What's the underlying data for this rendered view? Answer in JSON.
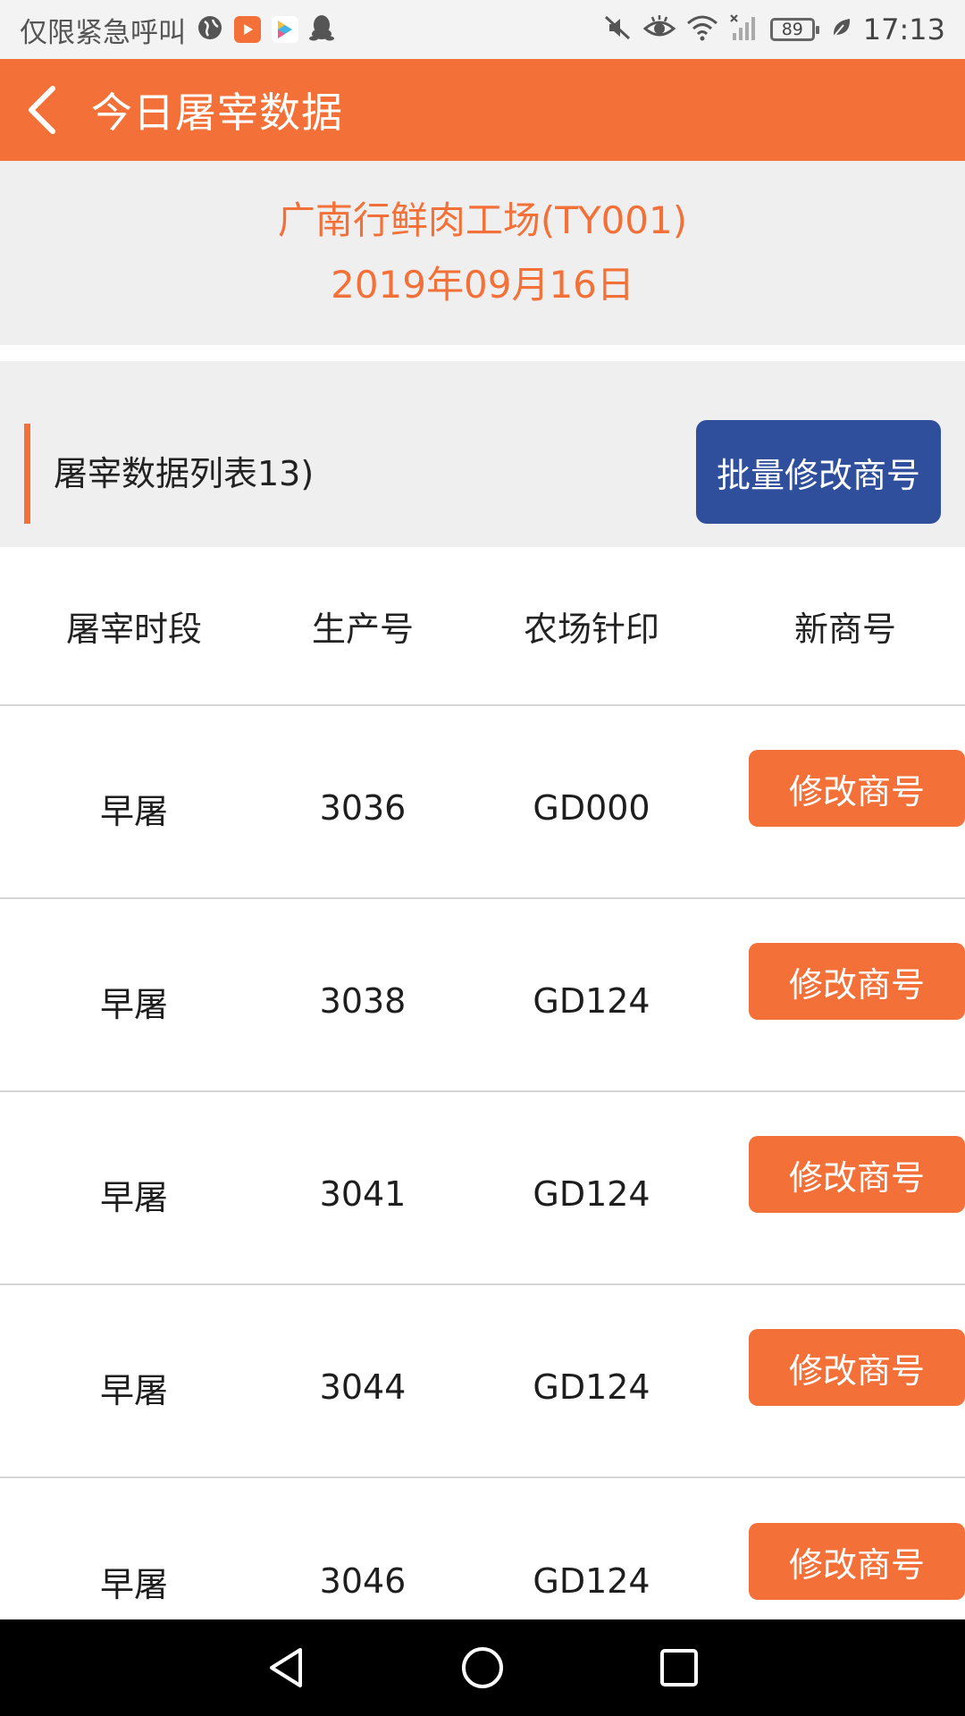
{
  "status_bar": {
    "carrier_text": "仅限紧急呼叫",
    "battery": "89",
    "time": "17:13"
  },
  "header": {
    "title": "今日屠宰数据"
  },
  "info": {
    "factory_name": "广南行鲜肉工场(TY001)",
    "date": "2019年09月16日"
  },
  "section": {
    "title": "屠宰数据列表13)",
    "batch_button_label": "批量修改商号"
  },
  "table": {
    "columns": [
      "屠宰时段",
      "生产号",
      "农场针印",
      "新商号"
    ],
    "rows": [
      {
        "period": "早屠",
        "production_no": "3036",
        "farm_stamp": "GD000",
        "action_label": "修改商号"
      },
      {
        "period": "早屠",
        "production_no": "3038",
        "farm_stamp": "GD124",
        "action_label": "修改商号"
      },
      {
        "period": "早屠",
        "production_no": "3041",
        "farm_stamp": "GD124",
        "action_label": "修改商号"
      },
      {
        "period": "早屠",
        "production_no": "3044",
        "farm_stamp": "GD124",
        "action_label": "修改商号"
      },
      {
        "period": "早屠",
        "production_no": "3046",
        "farm_stamp": "GD124",
        "action_label": "修改商号"
      }
    ]
  },
  "colors": {
    "accent_orange": "#f37139",
    "batch_button_blue": "#2f4f9c",
    "panel_gray": "#efefef"
  },
  "icons": {
    "back": "chevron-left-icon",
    "nav_back": "triangle-back-icon",
    "nav_home": "circle-home-icon",
    "nav_recent": "square-recent-icon"
  }
}
